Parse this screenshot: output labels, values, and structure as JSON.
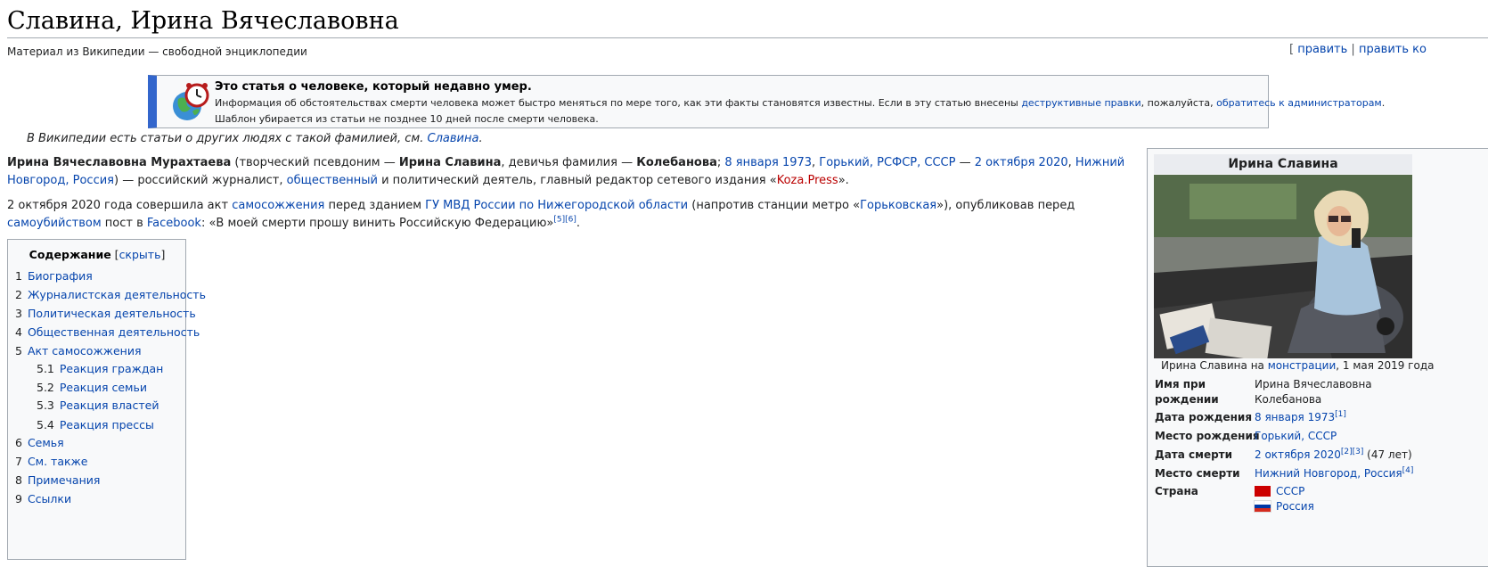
{
  "page": {
    "title": "Славина, Ирина Вячеславовна",
    "tagline": "Материал из Википедии — свободной энциклопедии",
    "edit_links": {
      "open": "[",
      "edit": "править",
      "sep": "|",
      "edit_code": "править ко"
    }
  },
  "notice": {
    "icon": "clock-globe-icon",
    "heading": "Это статья о человеке, который недавно умер.",
    "text1": "Информация об обстоятельствах смерти человека может быстро меняться по мере того, как эти факты становятся известны. Если в эту статью внесены ",
    "link1": "деструктивные правки",
    "text2": ", пожалуйста, ",
    "link2": "обратитесь к администраторам",
    "text3": ".",
    "text4": "Шаблон убирается из статьи не позднее 10 дней после смерти человека."
  },
  "hatnote": {
    "text": "В Википедии есть статьи о других людях с такой фамилией, см. ",
    "link": "Славина",
    "end": "."
  },
  "intro": {
    "name": "Ирина Вячеславовна Мурахтаева",
    "t1": " (творческий псевдоним — ",
    "pseudonym": "Ирина Славина",
    "t2": ", девичья фамилия — ",
    "maiden": "Колебанова",
    "t3": "; ",
    "birth_date": "8 января 1973",
    "comma1": ", ",
    "birth_place": "Горький, РСФСР, СССР",
    "dash": " — ",
    "death_date": "2 октября 2020",
    "comma2": ", ",
    "death_place": "Нижний Новгород, Россия",
    "t4": ") — российский журналист, ",
    "public": "общественный",
    "t5": " и политический деятель, главный редактор сетевого издания «",
    "outlet": "Koza.Press",
    "t6": "».",
    "p2_t1": "2 октября 2020 года совершила акт ",
    "self_immolation": "самосожжения",
    "p2_t2": " перед зданием ",
    "mvd": "ГУ МВД России по Нижегородской области",
    "p2_t3": " (напротив станции метро «",
    "metro": "Горьковская",
    "p2_t4": "»), опубликовав перед ",
    "suicide": "самоубийством",
    "p2_t5": " пост в ",
    "facebook": "Facebook",
    "p2_t6": ": «В моей смерти прошу винить Российскую Федерацию»",
    "ref5": "[5]",
    "ref6": "[6]",
    "p2_end": "."
  },
  "toc": {
    "title": "Содержание",
    "toggle_open": "[",
    "toggle": "скрыть",
    "toggle_close": "]",
    "items": [
      {
        "num": "1",
        "label": "Биография"
      },
      {
        "num": "2",
        "label": "Журналистская деятельность"
      },
      {
        "num": "3",
        "label": "Политическая деятельность"
      },
      {
        "num": "4",
        "label": "Общественная деятельность"
      },
      {
        "num": "5",
        "label": "Акт самосожжения"
      },
      {
        "num": "5.1",
        "label": "Реакция граждан"
      },
      {
        "num": "5.2",
        "label": "Реакция семьи"
      },
      {
        "num": "5.3",
        "label": "Реакция властей"
      },
      {
        "num": "5.4",
        "label": "Реакция прессы"
      },
      {
        "num": "6",
        "label": "Семья"
      },
      {
        "num": "7",
        "label": "См. также"
      },
      {
        "num": "8",
        "label": "Примечания"
      },
      {
        "num": "9",
        "label": "Ссылки"
      }
    ]
  },
  "infobox": {
    "title": "Ирина Славина",
    "caption_t1": "Ирина Славина на ",
    "caption_link": "монстрации",
    "caption_t2": ", 1 мая 2019 года",
    "rows": {
      "birth_name_label_1": "Имя при",
      "birth_name_label_2": "рождении",
      "birth_name_1": "Ирина Вячеславовна",
      "birth_name_2": "Колебанова",
      "birth_date_label": "Дата рождения",
      "birth_date": "8 января 1973",
      "birth_date_ref": "[1]",
      "birth_place_label": "Место рождения",
      "birth_place": "Горький, СССР",
      "death_date_label": "Дата смерти",
      "death_date": "2 октября 2020",
      "death_date_ref": "[2][3]",
      "age": " (47 лет)",
      "death_place_label": "Место смерти",
      "death_place": "Нижний Новгород, Россия",
      "death_place_ref": "[4]",
      "country_label": "Страна",
      "country_1": "СССР",
      "country_2": "Россия"
    },
    "colors": {
      "ussr_flag": "#cc0000",
      "russia_white": "#ffffff",
      "russia_blue": "#0039a6",
      "russia_red": "#d52b1e"
    }
  }
}
